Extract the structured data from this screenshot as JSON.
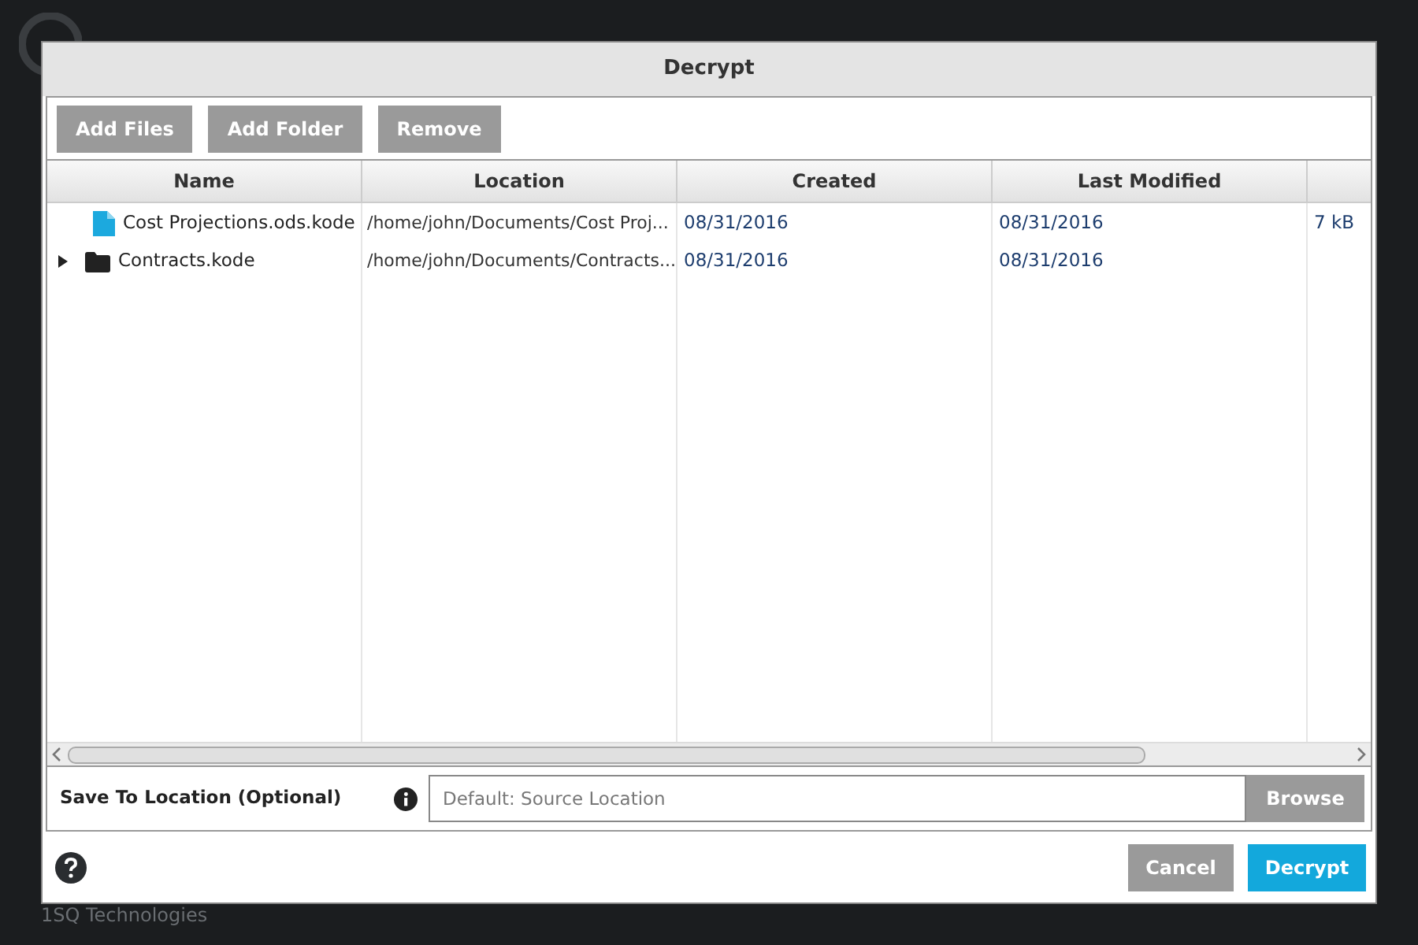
{
  "background": {
    "footer": "1SQ Technologies"
  },
  "dialog": {
    "title": "Decrypt",
    "toolbar": [
      "Add Files",
      "Add Folder",
      "Remove"
    ],
    "table": {
      "columns": [
        "Name",
        "Location",
        "Created",
        "Last Modified"
      ],
      "rows": [
        {
          "kind": "file",
          "name": "Cost Projections.ods.kode",
          "location": "/home/john/Documents/Cost Proj...",
          "created": "08/31/2016",
          "modified": "08/31/2016",
          "column_5": "7 kB"
        },
        {
          "kind": "folder",
          "expanded": false,
          "name": "Contracts.kode",
          "location": "/home/john/Documents/Contracts...",
          "created": "08/31/2016",
          "modified": "08/31/2016"
        }
      ]
    },
    "save_location": {
      "label": "Save To Location (Optional)",
      "placeholder": "Default: Source Location",
      "browse": "Browse"
    },
    "buttons": {
      "cancel": "Cancel",
      "confirm": "Decrypt"
    }
  }
}
